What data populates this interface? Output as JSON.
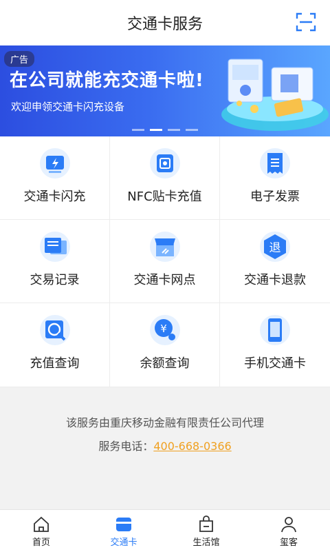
{
  "header": {
    "title": "交通卡服务",
    "scan_icon": "scan-icon"
  },
  "banner": {
    "ad_tag": "广告",
    "headline": "在公司就能充交通卡啦!",
    "subtitle": "欢迎申领交通卡闪充设备"
  },
  "services": [
    {
      "label": "交通卡闪充",
      "icon": "flash-card-icon"
    },
    {
      "label": "NFC贴卡充值",
      "icon": "nfc-icon"
    },
    {
      "label": "电子发票",
      "icon": "invoice-icon"
    },
    {
      "label": "交易记录",
      "icon": "record-icon"
    },
    {
      "label": "交通卡网点",
      "icon": "store-icon"
    },
    {
      "label": "交通卡退款",
      "icon": "refund-icon",
      "glyph": "退"
    },
    {
      "label": "充值查询",
      "icon": "search-icon"
    },
    {
      "label": "余额查询",
      "icon": "balance-icon",
      "glyph": "¥"
    },
    {
      "label": "手机交通卡",
      "icon": "phone-card-icon"
    }
  ],
  "footer": {
    "agent_text": "该服务由重庆移动金融有限责任公司代理",
    "phone_label": "服务电话：",
    "phone": "400-668-0366"
  },
  "tabbar": [
    {
      "label": "首页",
      "icon": "home-icon"
    },
    {
      "label": "交通卡",
      "icon": "card-icon",
      "active": true
    },
    {
      "label": "生活馆",
      "icon": "shop-icon"
    },
    {
      "label": "玺客",
      "icon": "user-icon"
    }
  ],
  "colors": {
    "accent": "#2b7cf6",
    "phone": "#f0a020",
    "banner": "#2c4ee0"
  }
}
